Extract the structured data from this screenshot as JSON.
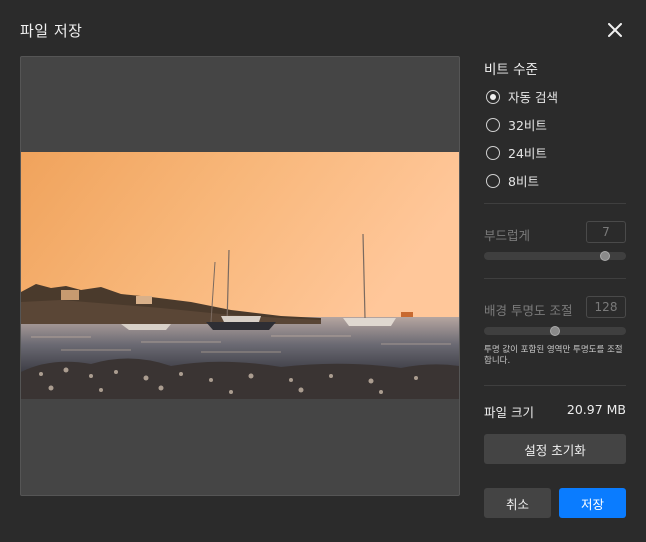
{
  "dialog": {
    "title": "파일 저장",
    "close_icon": "close-icon"
  },
  "bit_depth": {
    "title": "비트 수준",
    "options": [
      {
        "label": "자동 검색",
        "selected": true
      },
      {
        "label": "32비트",
        "selected": false
      },
      {
        "label": "24비트",
        "selected": false
      },
      {
        "label": "8비트",
        "selected": false
      }
    ]
  },
  "smoothness": {
    "label": "부드럽게",
    "value": "7",
    "level": 0.85,
    "enabled": false
  },
  "bg_transparency": {
    "label": "배경 투명도 조절",
    "value": "128",
    "level": 0.5,
    "enabled": false,
    "note": "투명 값이 포함된 영역만 투명도를 조절합니다."
  },
  "file_size": {
    "label": "파일 크기",
    "value": "20.97 MB"
  },
  "buttons": {
    "reset": "설정 초기화",
    "cancel": "취소",
    "save": "저장"
  },
  "colors": {
    "accent": "#0a7cff",
    "background": "#2b2b2b"
  }
}
